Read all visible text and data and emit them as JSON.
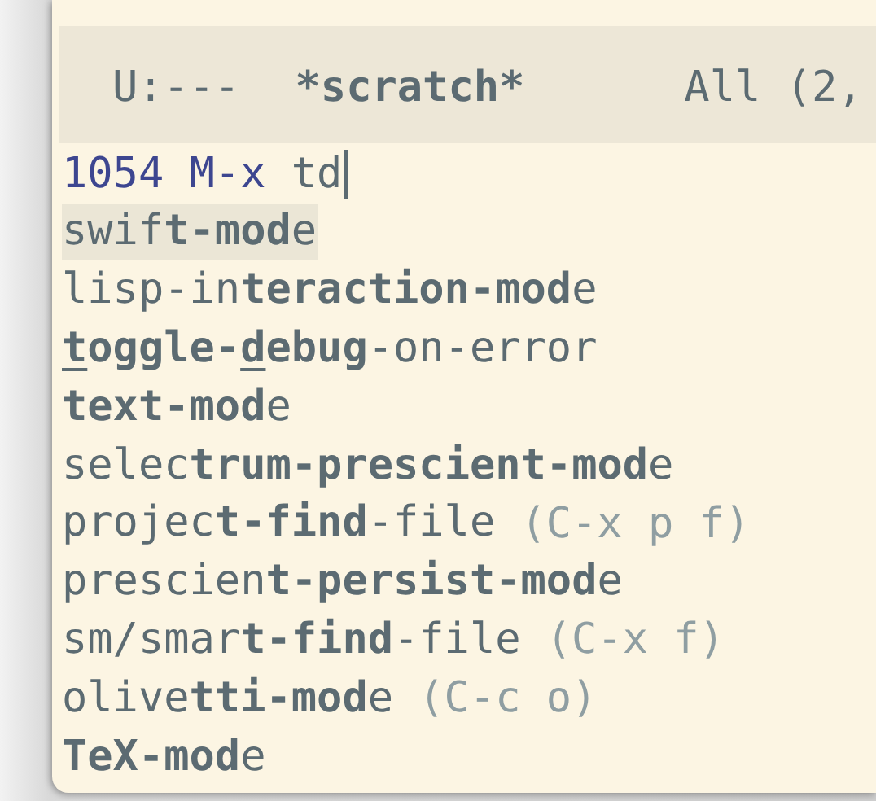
{
  "mode_line": {
    "state": "U:---",
    "buffer_name": "*scratch*",
    "position": "All (2,"
  },
  "minibuffer": {
    "prompt": "1054 M-x",
    "input": "td"
  },
  "candidates": [
    {
      "selected": true,
      "segments": [
        {
          "kind": "plain",
          "text": "swif"
        },
        {
          "kind": "match",
          "text": "t-mod"
        },
        {
          "kind": "plain",
          "text": "e"
        }
      ]
    },
    {
      "selected": false,
      "segments": [
        {
          "kind": "plain",
          "text": "lisp-in"
        },
        {
          "kind": "match",
          "text": "teraction-mod"
        },
        {
          "kind": "plain",
          "text": "e"
        }
      ]
    },
    {
      "selected": false,
      "segments": [
        {
          "kind": "initial",
          "text": "t"
        },
        {
          "kind": "match",
          "text": "oggle-"
        },
        {
          "kind": "initial",
          "text": "d"
        },
        {
          "kind": "match",
          "text": "ebug"
        },
        {
          "kind": "plain",
          "text": "-on-error"
        }
      ]
    },
    {
      "selected": false,
      "segments": [
        {
          "kind": "match",
          "text": "text-mod"
        },
        {
          "kind": "plain",
          "text": "e"
        }
      ]
    },
    {
      "selected": false,
      "segments": [
        {
          "kind": "plain",
          "text": "selec"
        },
        {
          "kind": "match",
          "text": "trum-prescient-mod"
        },
        {
          "kind": "plain",
          "text": "e"
        }
      ]
    },
    {
      "selected": false,
      "segments": [
        {
          "kind": "plain",
          "text": "projec"
        },
        {
          "kind": "match",
          "text": "t-find"
        },
        {
          "kind": "plain",
          "text": "-file"
        }
      ],
      "keybinding": "(C-x p f)"
    },
    {
      "selected": false,
      "segments": [
        {
          "kind": "plain",
          "text": "prescien"
        },
        {
          "kind": "match",
          "text": "t-persist-mod"
        },
        {
          "kind": "plain",
          "text": "e"
        }
      ]
    },
    {
      "selected": false,
      "segments": [
        {
          "kind": "plain",
          "text": "sm/smar"
        },
        {
          "kind": "match",
          "text": "t-find"
        },
        {
          "kind": "plain",
          "text": "-file"
        }
      ],
      "keybinding": "(C-x f)"
    },
    {
      "selected": false,
      "segments": [
        {
          "kind": "plain",
          "text": "olive"
        },
        {
          "kind": "match",
          "text": "tti-mod"
        },
        {
          "kind": "plain",
          "text": "e"
        }
      ],
      "keybinding": "(C-c o)"
    },
    {
      "selected": false,
      "segments": [
        {
          "kind": "match",
          "text": "TeX-mod"
        },
        {
          "kind": "plain",
          "text": "e"
        }
      ]
    }
  ]
}
